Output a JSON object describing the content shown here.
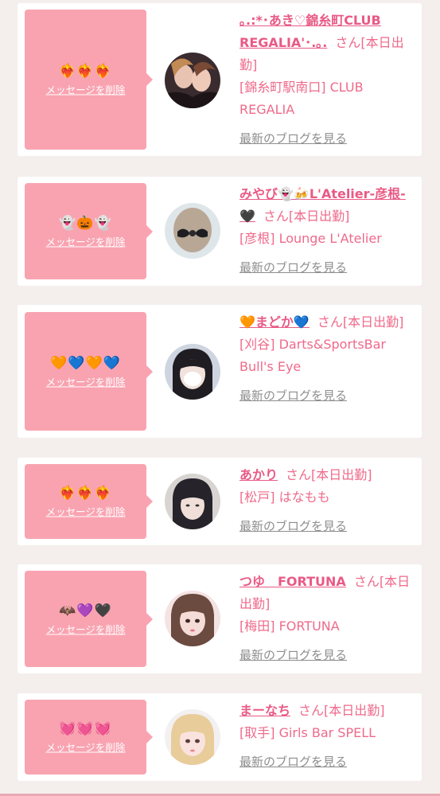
{
  "delete_label": "メッセージを削除",
  "blog_label": "最新のブログを見る",
  "suffix": "さん[本日出勤]",
  "cards": [
    {
      "emoji": "❤️‍🔥❤️‍🔥❤️‍🔥",
      "name": "｡.:*･あき♡錦糸町CLUB REGALIA'･.｡.",
      "area": "[錦糸町駅南口] CLUB REGALIA"
    },
    {
      "emoji": "👻🎃👻",
      "name": "みやび👻🍻L'Atelier-彦根-🖤",
      "area": "[彦根] Lounge L'Atelier"
    },
    {
      "emoji": "🧡💙🧡💙",
      "name": "🧡まどか💙",
      "area": "[刈谷] Darts&SportsBar Bull's Eye"
    },
    {
      "emoji": "❤️‍🔥❤️‍🔥❤️‍🔥",
      "name": "あかり",
      "area": "[松戸] はなもも"
    },
    {
      "emoji": "🦇💜🖤",
      "name": "つゆ　FORTUNA",
      "area": "[梅田] FORTUNA"
    },
    {
      "emoji": "💓💓💓",
      "name": "まーなち",
      "area": "[取手] Girls Bar SPELL"
    }
  ]
}
